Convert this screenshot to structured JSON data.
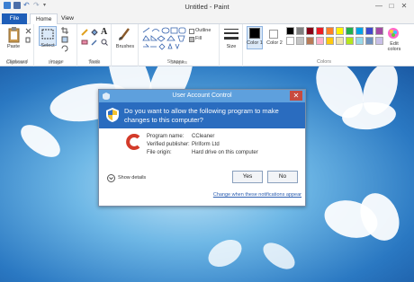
{
  "window": {
    "title": "Untitled - Paint",
    "controls": {
      "minimize": "—",
      "maximize": "□",
      "close": "✕"
    }
  },
  "tabs": {
    "file": "File",
    "home": "Home",
    "view": "View"
  },
  "ribbon": {
    "paste": "Paste",
    "select": "Select",
    "brushes": "Brushes",
    "shapes_outline": "Outline",
    "shapes_fill": "Fill",
    "size": "Size",
    "color1": "Color 1",
    "color2": "Color 2",
    "edit_colors": "Edit colors",
    "groups": {
      "clipboard": "Clipboard",
      "image": "Image",
      "tools": "Tools",
      "shapes": "Shapes",
      "colors": "Colors"
    }
  },
  "palette": [
    "#000000",
    "#7f7f7f",
    "#880015",
    "#ed1c24",
    "#ff7f27",
    "#fff200",
    "#22b14c",
    "#00a2e8",
    "#3f48cc",
    "#a349a4",
    "#ffffff",
    "#c3c3c3",
    "#b97a57",
    "#ffaec9",
    "#ffc90e",
    "#efe4b0",
    "#b5e61d",
    "#99d9ea",
    "#7092be",
    "#c8bfe7"
  ],
  "uac": {
    "title": "User Account Control",
    "question": "Do you want to allow the following program to make changes to this computer?",
    "program_label": "Program name:",
    "program_value": "CCleaner",
    "publisher_label": "Verified publisher:",
    "publisher_value": "Piriform Ltd",
    "origin_label": "File origin:",
    "origin_value": "Hard drive on this computer",
    "show_details": "Show details",
    "yes": "Yes",
    "no": "No",
    "change_link": "Change when these notifications appear"
  },
  "colors": {
    "accent": "#1e5eb8",
    "uac_header": "#2a6cbf",
    "uac_titlebar": "#5ea0dd",
    "close_red": "#c74b3f"
  }
}
